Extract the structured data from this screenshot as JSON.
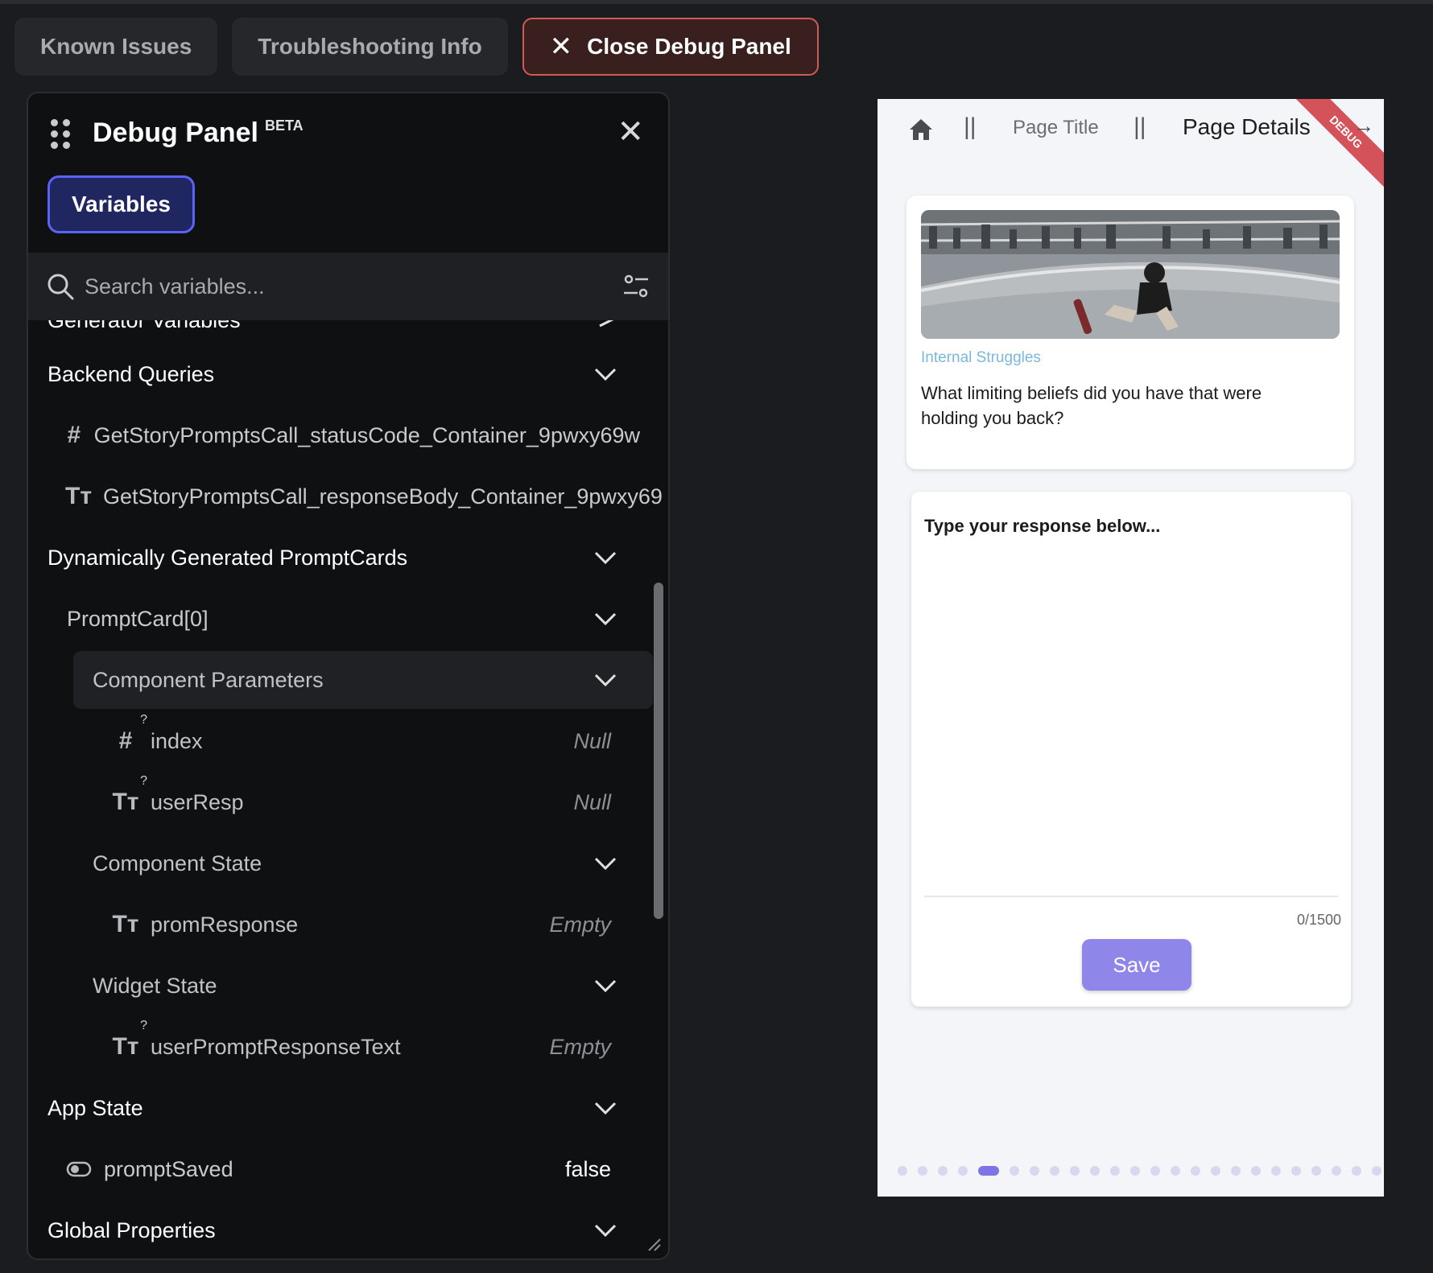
{
  "tabs": {
    "known_issues": "Known Issues",
    "troubleshooting": "Troubleshooting Info",
    "close_debug": "Close Debug Panel"
  },
  "panel": {
    "title": "Debug Panel",
    "badge": "BETA",
    "variables_tab": "Variables",
    "search_placeholder": "Search variables...",
    "rows": {
      "generator": "Generator Variables",
      "backend": "Backend Queries",
      "status_code": "GetStoryPromptsCall_statusCode_Container_9pwxy69w",
      "response_body": "GetStoryPromptsCall_responseBody_Container_9pwxy69",
      "dynamic": "Dynamically Generated PromptCards",
      "prompt_card": "PromptCard[0]",
      "comp_params": "Component Parameters",
      "index": "index",
      "index_val": "Null",
      "user_resp": "userResp",
      "user_resp_val": "Null",
      "comp_state": "Component State",
      "prom_response": "promResponse",
      "prom_response_val": "Empty",
      "widget_state": "Widget State",
      "user_prompt_text": "userPromptResponseText",
      "user_prompt_text_val": "Empty",
      "app_state": "App State",
      "prompt_saved": "promptSaved",
      "prompt_saved_val": "false",
      "global_props": "Global Properties"
    }
  },
  "preview": {
    "nav_title": "Page Title",
    "nav_details": "Page Details",
    "separator": "||",
    "ribbon": "DEBUG",
    "category": "Internal Struggles",
    "question": "What limiting beliefs did you have that were holding you back?",
    "response_placeholder": "Type your response below...",
    "counter": "0/1500",
    "save": "Save",
    "page_count": 24,
    "active_page": 5
  }
}
